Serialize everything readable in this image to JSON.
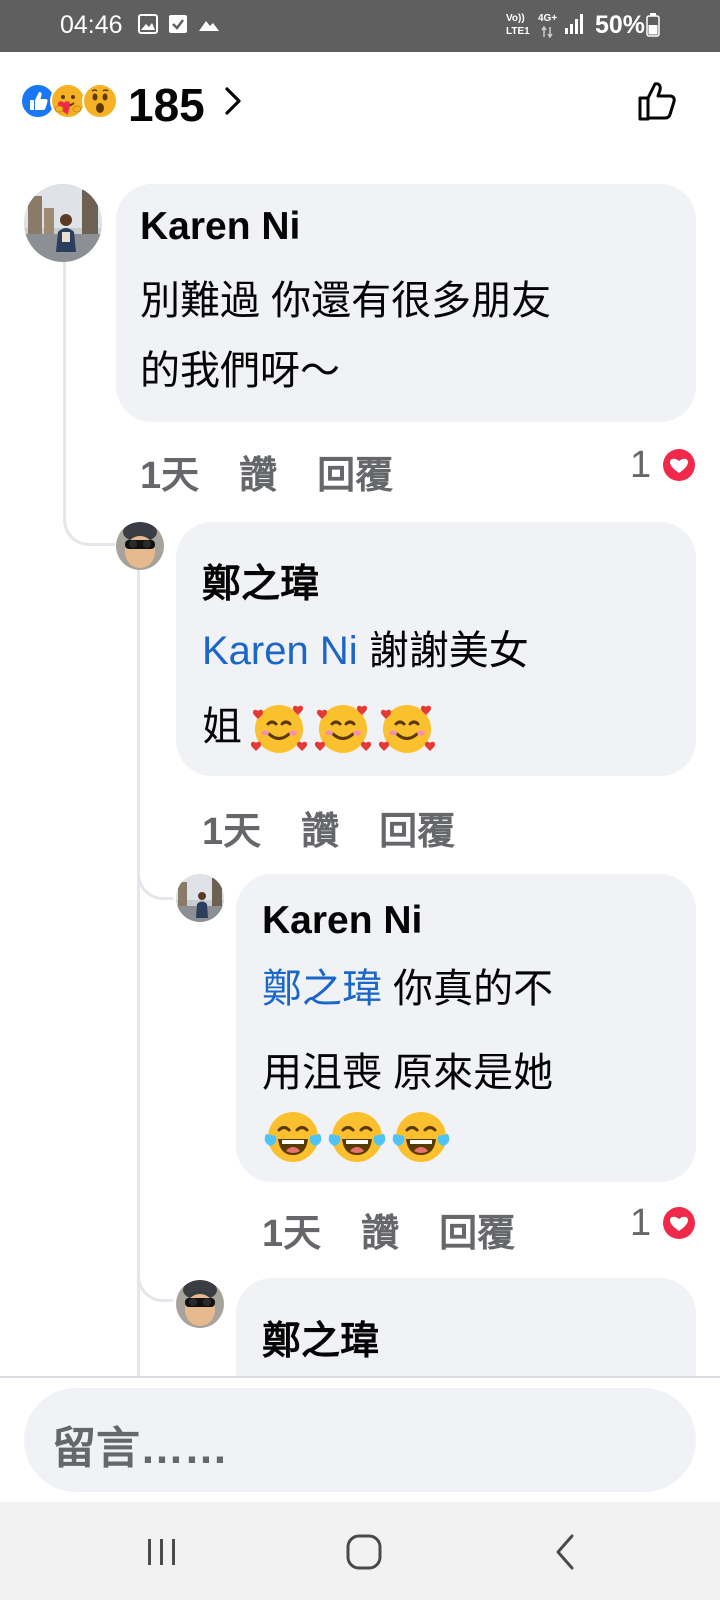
{
  "status_bar": {
    "time": "04:46",
    "network_top": "Vo))",
    "network_bottom": "LTE1",
    "net_type": "4G+",
    "battery": "50%"
  },
  "reactions": {
    "count": "185",
    "emojis": [
      "like",
      "care",
      "wow"
    ]
  },
  "comments": [
    {
      "author": "Karen Ni",
      "lines": [
        "別難過 你還有很多朋友",
        "的我們呀～"
      ],
      "time": "1天",
      "like_label": "讚",
      "reply_label": "回覆",
      "reaction_count": "1"
    },
    {
      "author": "鄭之瑋",
      "mention": "Karen Ni",
      "line1_rest": " 謝謝美女",
      "line2": "姐",
      "emoji": [
        "smiling-face-with-hearts",
        "smiling-face-with-hearts",
        "smiling-face-with-hearts"
      ],
      "time": "1天",
      "like_label": "讚",
      "reply_label": "回覆"
    },
    {
      "author": "Karen Ni",
      "mention": "鄭之瑋",
      "line1_rest": " 你真的不",
      "line2": "用沮喪 原來是她",
      "emoji": [
        "face-with-tears-of-joy",
        "face-with-tears-of-joy",
        "face-with-tears-of-joy"
      ],
      "time": "1天",
      "like_label": "讚",
      "reply_label": "回覆",
      "reaction_count": "1"
    },
    {
      "author": "鄭之瑋"
    }
  ],
  "compose": {
    "placeholder": "留言……"
  },
  "colors": {
    "bubble": "#f0f2f5",
    "mention": "#1a66c9",
    "meta": "#65676b",
    "heart": "#f02849",
    "like_blue": "#1877f2"
  }
}
